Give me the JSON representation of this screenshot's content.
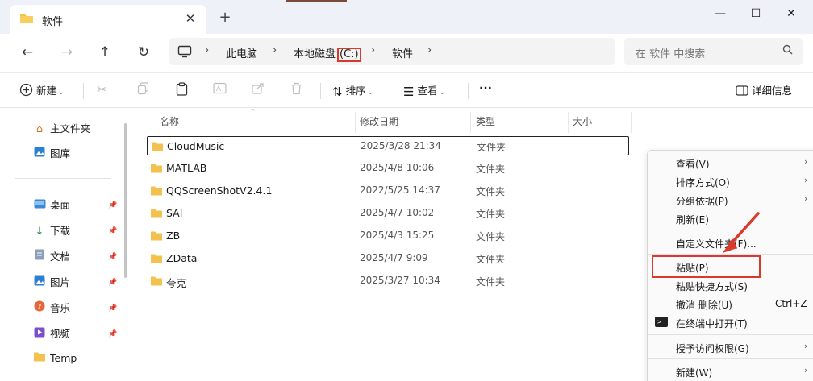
{
  "tab": {
    "title": "软件",
    "close": "✕",
    "new": "+"
  },
  "window": {
    "minimize": "—",
    "maximize": "☐",
    "close": "✕"
  },
  "nav": {
    "back": "←",
    "forward": "→",
    "up": "↑",
    "refresh": "↻"
  },
  "address": {
    "crumbs": [
      "此电脑",
      "本地磁盘",
      "(C:)",
      "软件"
    ],
    "separator": "›"
  },
  "search": {
    "placeholder": "在 软件 中搜索"
  },
  "toolbar": {
    "new_label": "新建",
    "sort_label": "排序",
    "view_label": "查看",
    "more_label": "···",
    "details_label": "详细信息"
  },
  "sidebar": {
    "items": [
      {
        "label": "主文件夹",
        "icon": "home-icon"
      },
      {
        "label": "图库",
        "icon": "gallery-icon"
      },
      {
        "label": "桌面",
        "icon": "desktop-icon",
        "pinned": true
      },
      {
        "label": "下载",
        "icon": "download-icon",
        "pinned": true
      },
      {
        "label": "文档",
        "icon": "document-icon",
        "pinned": true
      },
      {
        "label": "图片",
        "icon": "pictures-icon",
        "pinned": true
      },
      {
        "label": "音乐",
        "icon": "music-icon",
        "pinned": true
      },
      {
        "label": "视频",
        "icon": "video-icon",
        "pinned": true
      },
      {
        "label": "Temp",
        "icon": "folder-icon"
      }
    ]
  },
  "files": {
    "columns": [
      "名称",
      "修改日期",
      "类型",
      "大小"
    ],
    "rows": [
      {
        "name": "CloudMusic",
        "date": "2025/3/28 21:34",
        "type": "文件夹"
      },
      {
        "name": "MATLAB",
        "date": "2025/4/8 10:06",
        "type": "文件夹"
      },
      {
        "name": "QQScreenShotV2.4.1",
        "date": "2022/5/25 14:37",
        "type": "文件夹"
      },
      {
        "name": "SAI",
        "date": "2025/4/7 10:02",
        "type": "文件夹"
      },
      {
        "name": "ZB",
        "date": "2025/4/3 15:25",
        "type": "文件夹"
      },
      {
        "name": "ZData",
        "date": "2025/4/7 9:09",
        "type": "文件夹"
      },
      {
        "name": "夸克",
        "date": "2025/3/27 10:34",
        "type": "文件夹"
      }
    ]
  },
  "context_menu": {
    "items": [
      {
        "label": "查看(V)",
        "submenu": true
      },
      {
        "label": "排序方式(O)",
        "submenu": true
      },
      {
        "label": "分组依据(P)",
        "submenu": true
      },
      {
        "label": "刷新(E)"
      },
      {
        "label": "自定义文件夹(F)..."
      },
      {
        "label": "粘贴(P)"
      },
      {
        "label": "粘贴快捷方式(S)"
      },
      {
        "label": "撤消 删除(U)",
        "shortcut": "Ctrl+Z"
      },
      {
        "label": "在终端中打开(T)",
        "icon": "terminal-icon"
      },
      {
        "label": "授予访问权限(G)",
        "submenu": true
      },
      {
        "label": "新建(W)",
        "submenu": true
      }
    ],
    "submenu_arrow": "›",
    "terminal_glyph": ">_"
  },
  "colors": {
    "highlight": "#d93a2b",
    "folder": "#f2c14e",
    "accent": "#0067c0"
  }
}
